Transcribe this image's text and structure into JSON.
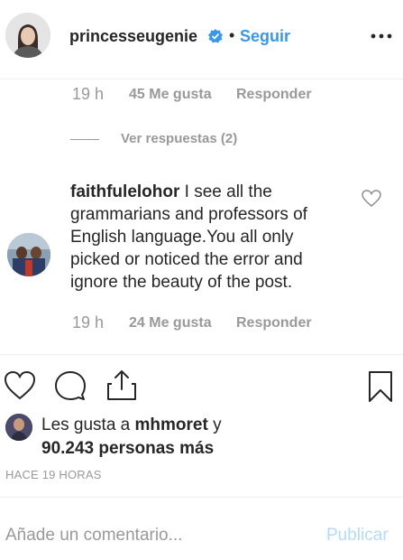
{
  "header": {
    "username": "princesseugenie",
    "separator": "•",
    "follow_label": "Seguir"
  },
  "previous_comment": {
    "time": "19 h",
    "likes": "45 Me gusta",
    "reply_label": "Responder",
    "view_replies": "Ver respuestas (2)"
  },
  "comment": {
    "username": "faithfulelohor",
    "text": "I see all the grammarians and professors of English language.You all only picked or noticed the error and ignore the beauty of the post.",
    "time": "19 h",
    "likes": "24 Me gusta",
    "reply_label": "Responder"
  },
  "likes": {
    "prefix": "Les gusta a ",
    "user": "mhmoret",
    "connector": " y",
    "count": "90.243 personas más"
  },
  "timestamp": "HACE 19 HORAS",
  "comment_box": {
    "placeholder": "Añade un comentario...",
    "publish_label": "Publicar"
  },
  "colors": {
    "accent": "#3897f0",
    "verified": "#3897f0",
    "muted": "#999999",
    "publish_disabled": "#b3dbff"
  },
  "icons": [
    "verified-badge-icon",
    "more-options-icon",
    "heart-icon",
    "comment-icon",
    "share-icon",
    "bookmark-icon"
  ]
}
